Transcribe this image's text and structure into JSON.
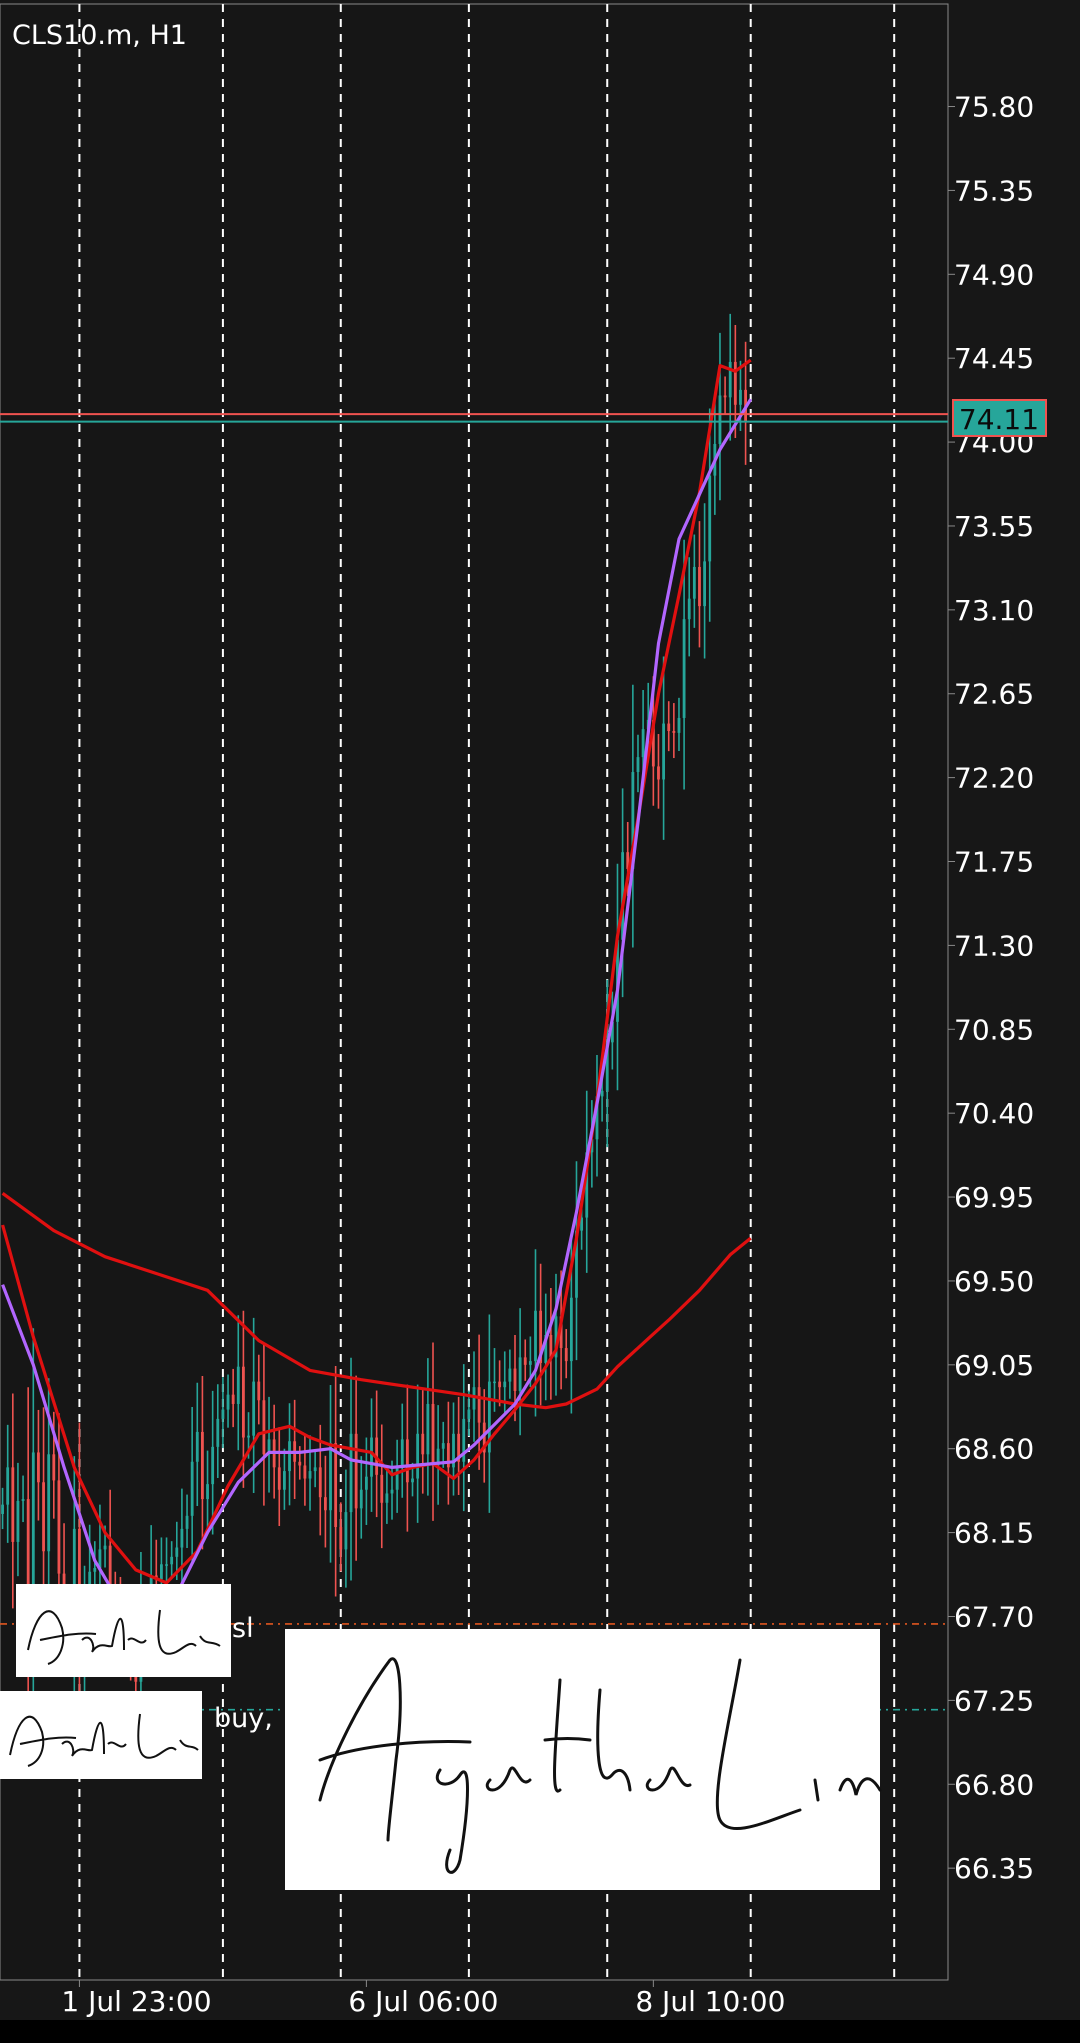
{
  "chart_data": {
    "type": "candlestick",
    "title": "CLS10.m, H1",
    "symbol": "CLS10.m",
    "timeframe": "H1",
    "ylim": [
      65.75,
      76.35
    ],
    "y_ticks": [
      75.8,
      75.35,
      74.9,
      74.45,
      74.0,
      73.55,
      73.1,
      72.65,
      72.2,
      71.75,
      71.3,
      70.85,
      70.4,
      69.95,
      69.5,
      69.05,
      68.6,
      68.15,
      67.7,
      67.25,
      66.8,
      66.35
    ],
    "y_tick_labels": [
      "75.80",
      "75.35",
      "74.90",
      "74.45",
      "74.00",
      "73.55",
      "73.10",
      "72.65",
      "72.20",
      "71.75",
      "71.30",
      "70.85",
      "70.40",
      "69.95",
      "69.50",
      "69.05",
      "68.60",
      "68.15",
      "67.70",
      "67.25",
      "66.80",
      "66.35"
    ],
    "x_labels": [
      {
        "label": "1 Jul 23:00",
        "bar": 15
      },
      {
        "label": "6 Jul 06:00",
        "bar": 71
      },
      {
        "label": "8 Jul 10:00",
        "bar": 127
      }
    ],
    "bar_count": 185,
    "candles_plotted": 146,
    "period_separators_bar": [
      15,
      43,
      66,
      91,
      118,
      146,
      174
    ],
    "current_price": {
      "value": 74.11,
      "label": "74.11",
      "color": "#26a69a"
    },
    "red_level": {
      "value": 74.15,
      "color": "#ef5350"
    },
    "trade_lines": [
      {
        "label": "sl",
        "value": 67.66,
        "color": "#e0561f"
      },
      {
        "label": "buy,",
        "value": 67.2,
        "color": "#26a69a"
      }
    ],
    "moving_averages": [
      {
        "color": "#e01010",
        "points": [
          [
            0,
            69.97
          ],
          [
            10,
            69.77
          ],
          [
            20,
            69.63
          ],
          [
            30,
            69.54
          ],
          [
            40,
            69.45
          ],
          [
            50,
            69.18
          ],
          [
            60,
            69.02
          ],
          [
            70,
            68.97
          ],
          [
            80,
            68.93
          ],
          [
            90,
            68.89
          ],
          [
            100,
            68.84
          ],
          [
            106,
            68.82
          ],
          [
            110,
            68.84
          ],
          [
            116,
            68.92
          ],
          [
            120,
            69.04
          ],
          [
            126,
            69.19
          ],
          [
            130,
            69.29
          ],
          [
            136,
            69.45
          ],
          [
            142,
            69.64
          ],
          [
            146,
            69.73
          ]
        ]
      },
      {
        "color": "#e01010",
        "points": [
          [
            0,
            69.8
          ],
          [
            6,
            69.2
          ],
          [
            14,
            68.5
          ],
          [
            20,
            68.15
          ],
          [
            26,
            67.95
          ],
          [
            32,
            67.88
          ],
          [
            38,
            68.05
          ],
          [
            44,
            68.4
          ],
          [
            50,
            68.68
          ],
          [
            56,
            68.72
          ],
          [
            60,
            68.66
          ],
          [
            64,
            68.62
          ],
          [
            68,
            68.6
          ],
          [
            72,
            68.58
          ],
          [
            76,
            68.46
          ],
          [
            80,
            68.5
          ],
          [
            84,
            68.52
          ],
          [
            88,
            68.44
          ],
          [
            92,
            68.54
          ],
          [
            96,
            68.68
          ],
          [
            100,
            68.81
          ],
          [
            104,
            68.95
          ],
          [
            108,
            69.13
          ],
          [
            112,
            69.73
          ],
          [
            116,
            70.47
          ],
          [
            120,
            71.35
          ],
          [
            124,
            71.98
          ],
          [
            128,
            72.65
          ],
          [
            132,
            73.18
          ],
          [
            136,
            73.73
          ],
          [
            140,
            74.41
          ],
          [
            143,
            74.38
          ],
          [
            146,
            74.44
          ]
        ]
      },
      {
        "color": "#b266ff",
        "points": [
          [
            0,
            69.48
          ],
          [
            6,
            69.05
          ],
          [
            12,
            68.5
          ],
          [
            18,
            68.0
          ],
          [
            24,
            67.72
          ],
          [
            30,
            67.67
          ],
          [
            34,
            67.82
          ],
          [
            40,
            68.15
          ],
          [
            46,
            68.42
          ],
          [
            52,
            68.58
          ],
          [
            58,
            68.58
          ],
          [
            64,
            68.6
          ],
          [
            68,
            68.54
          ],
          [
            72,
            68.52
          ],
          [
            76,
            68.5
          ],
          [
            80,
            68.51
          ],
          [
            84,
            68.52
          ],
          [
            88,
            68.53
          ],
          [
            92,
            68.62
          ],
          [
            96,
            68.73
          ],
          [
            100,
            68.84
          ],
          [
            104,
            69.02
          ],
          [
            108,
            69.35
          ],
          [
            112,
            69.87
          ],
          [
            116,
            70.45
          ],
          [
            120,
            71.06
          ],
          [
            124,
            71.96
          ],
          [
            128,
            72.92
          ],
          [
            132,
            73.48
          ],
          [
            136,
            73.72
          ],
          [
            140,
            73.96
          ],
          [
            146,
            74.23
          ]
        ]
      }
    ],
    "closes": [
      68.3,
      68.5,
      68.1,
      68.32,
      68.33,
      67.61,
      68.58,
      68.42,
      68.05,
      68.57,
      68.43,
      67.93,
      67.66,
      67.64,
      68.17,
      67.42,
      67.66,
      67.94,
      67.96,
      68.06,
      68.08,
      67.82,
      67.72,
      67.58,
      67.56,
      67.47,
      67.35,
      67.68,
      67.69,
      67.92,
      67.9,
      67.98,
      67.98,
      68.02,
      68.07,
      68.17,
      68.24,
      68.53,
      68.69,
      68.33,
      68.41,
      68.61,
      68.76,
      68.81,
      68.89,
      68.84,
      69.04,
      68.66,
      68.67,
      68.96,
      68.86,
      68.57,
      68.65,
      68.5,
      68.38,
      68.48,
      68.64,
      68.53,
      68.51,
      68.44,
      68.48,
      68.5,
      68.34,
      68.27,
      68.63,
      68.18,
      68.06,
      68.26,
      68.68,
      68.28,
      68.38,
      68.45,
      68.66,
      68.46,
      68.31,
      68.36,
      68.38,
      68.51,
      68.65,
      68.42,
      68.44,
      68.68,
      68.57,
      68.84,
      68.51,
      68.6,
      68.63,
      68.5,
      68.68,
      68.53,
      68.76,
      68.81,
      68.93,
      68.74,
      68.58,
      68.96,
      68.96,
      68.93,
      68.96,
      69.03,
      68.91,
      69.09,
      69.05,
      69.07,
      69.34,
      69.06,
      69.21,
      69.09,
      69.31,
      69.14,
      69.07,
      69.41,
      69.77,
      69.84,
      70.19,
      70.26,
      70.49,
      70.52,
      70.78,
      70.89,
      71.33,
      71.8,
      71.71,
      72.23,
      72.31,
      72.46,
      72.51,
      72.26,
      72.19,
      72.49,
      72.45,
      72.44,
      72.52,
      73.05,
      73.16,
      73.33,
      73.12,
      73.36,
      73.82,
      73.99,
      74.25,
      74.24,
      74.43,
      74.2,
      74.28,
      74.11
    ]
  }
}
